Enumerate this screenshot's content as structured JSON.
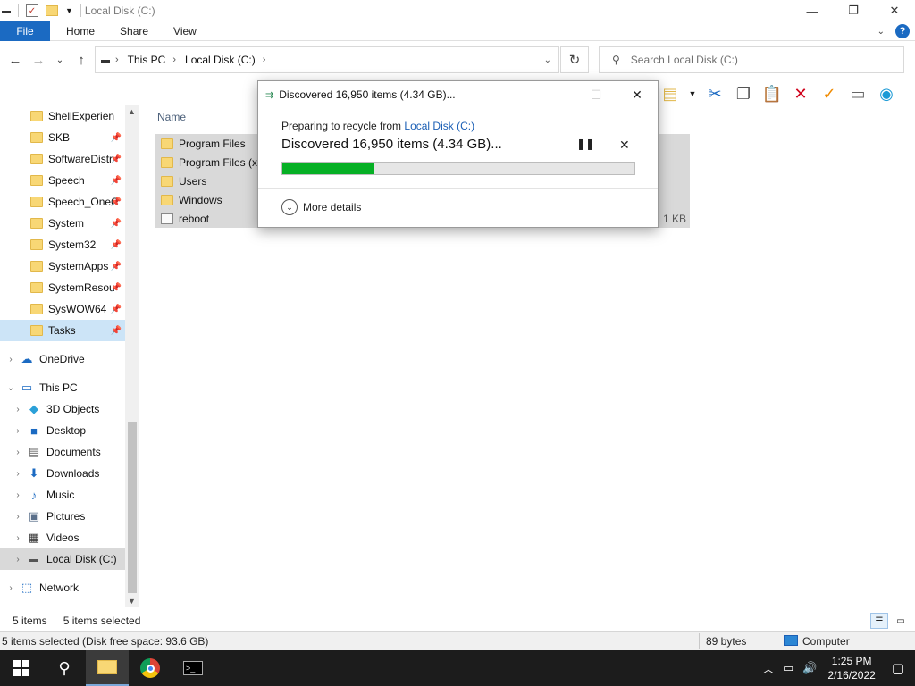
{
  "window": {
    "title": "Local Disk (C:)",
    "controls": {
      "minimize": "—",
      "maximize": "❐",
      "close": "✕"
    }
  },
  "ribbon": {
    "tabs": [
      "File",
      "Home",
      "Share",
      "View"
    ]
  },
  "address": {
    "crumbs": [
      "This PC",
      "Local Disk (C:)"
    ],
    "search_placeholder": "Search Local Disk (C:)"
  },
  "nav": {
    "quick_access": [
      {
        "label": "ShellExperien"
      },
      {
        "label": "SKB"
      },
      {
        "label": "SoftwareDistr"
      },
      {
        "label": "Speech"
      },
      {
        "label": "Speech_OneC"
      },
      {
        "label": "System"
      },
      {
        "label": "System32"
      },
      {
        "label": "SystemApps"
      },
      {
        "label": "SystemResou"
      },
      {
        "label": "SysWOW64"
      },
      {
        "label": "Tasks"
      }
    ],
    "onedrive": "OneDrive",
    "this_pc": "This PC",
    "pc_items": [
      {
        "label": "3D Objects"
      },
      {
        "label": "Desktop"
      },
      {
        "label": "Documents"
      },
      {
        "label": "Downloads"
      },
      {
        "label": "Music"
      },
      {
        "label": "Pictures"
      },
      {
        "label": "Videos"
      },
      {
        "label": "Local Disk (C:)"
      }
    ],
    "network": "Network"
  },
  "files": {
    "column_name": "Name",
    "rows": [
      {
        "name": "Program Files",
        "size": ""
      },
      {
        "name": "Program Files (x8",
        "size": ""
      },
      {
        "name": "Users",
        "size": ""
      },
      {
        "name": "Windows",
        "size": ""
      },
      {
        "name": "reboot",
        "size": "1 KB"
      }
    ]
  },
  "status": {
    "items": "5 items",
    "selected": "5 items selected",
    "detail": "5 items selected (Disk free space: 93.6 GB)",
    "bytes": "89 bytes",
    "computer": "Computer"
  },
  "dialog": {
    "title": "Discovered 16,950 items (4.34 GB)...",
    "sub_prefix": "Preparing to recycle from ",
    "sub_link": "Local Disk (C:)",
    "main": "Discovered 16,950 items (4.34 GB)...",
    "progress": 0.26,
    "more_details": "More details"
  },
  "taskbar": {
    "time": "1:25 PM",
    "date": "2/16/2022"
  },
  "colors": {
    "accent": "#1b6ac2",
    "progress": "#06b025",
    "selection": "#cce4f7",
    "taskbar": "#1c1c1c"
  }
}
